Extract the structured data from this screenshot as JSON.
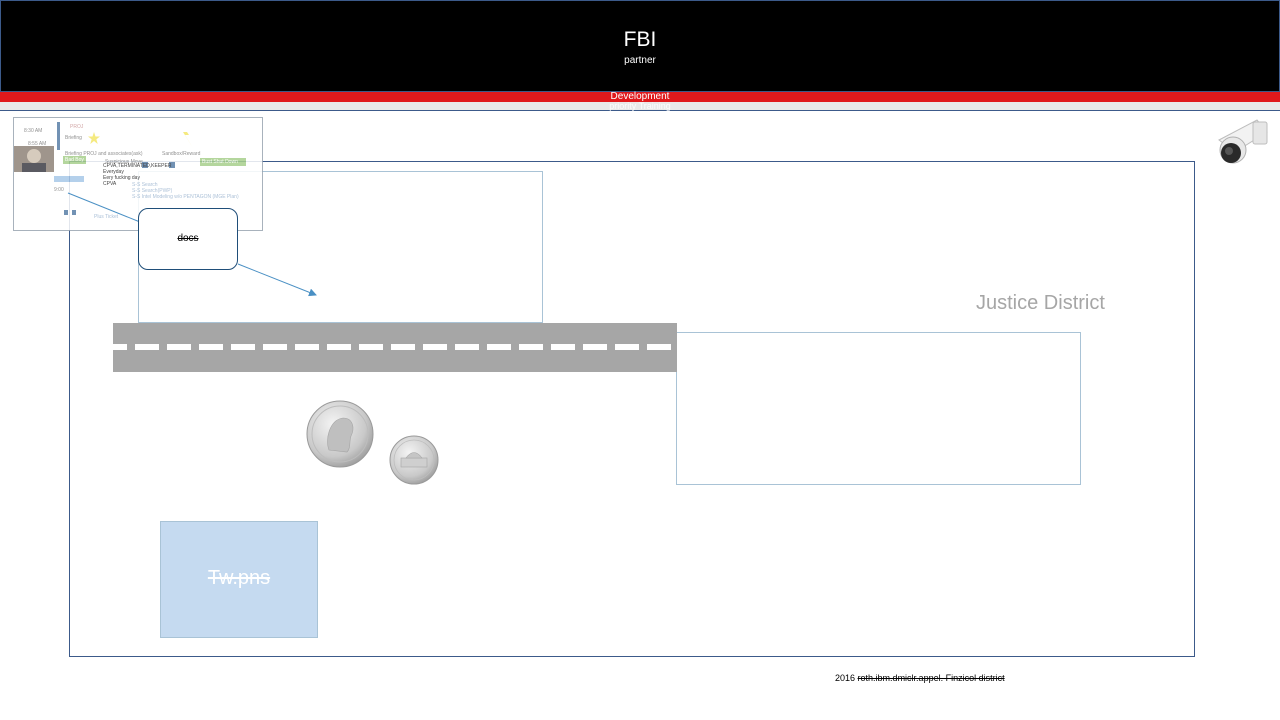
{
  "header": {
    "title": "FBI",
    "subtitle": "partner",
    "dev_label": "Development",
    "dev_sub": "priority Training"
  },
  "thumbnail": {
    "times": [
      "8:30 AM",
      "8:55 AM",
      "9:00"
    ],
    "rows": [
      "PROJ",
      "Briefing",
      "Briefing PROJ and associates(ask)",
      "Suspicious Move",
      "Sandbox/Reward"
    ],
    "green_labels": [
      "Bad Boy",
      "Bust Shut Down"
    ],
    "list": [
      "CPVA,TERMINATED,KEEPER",
      "Everyday",
      "Eery fucking day",
      "CPVA"
    ],
    "notes": [
      "S-S Search",
      "S-S Search(PWP)",
      "S-S Intel Modeling w/o PENTAGON (MGE Plan)"
    ],
    "footer_note": "Plus Ticket"
  },
  "docs_label": "docs",
  "district_label": "Justice District",
  "twpns_label": "Tw.pns",
  "footer": {
    "year": "2016",
    "struck": "roth.ibm.dmiclr.appel. Finzicol district"
  },
  "icons": {
    "camera": "security-camera-icon",
    "dime": "dime-coin-icon",
    "nickel": "nickel-coin-icon"
  },
  "colors": {
    "header_bg": "#000000",
    "red_bar": "#e0191c",
    "frame": "#3c5a8a",
    "road": "#a6a6a6",
    "twpns_fill": "#c5daf0",
    "arrow": "#4a90c4"
  }
}
